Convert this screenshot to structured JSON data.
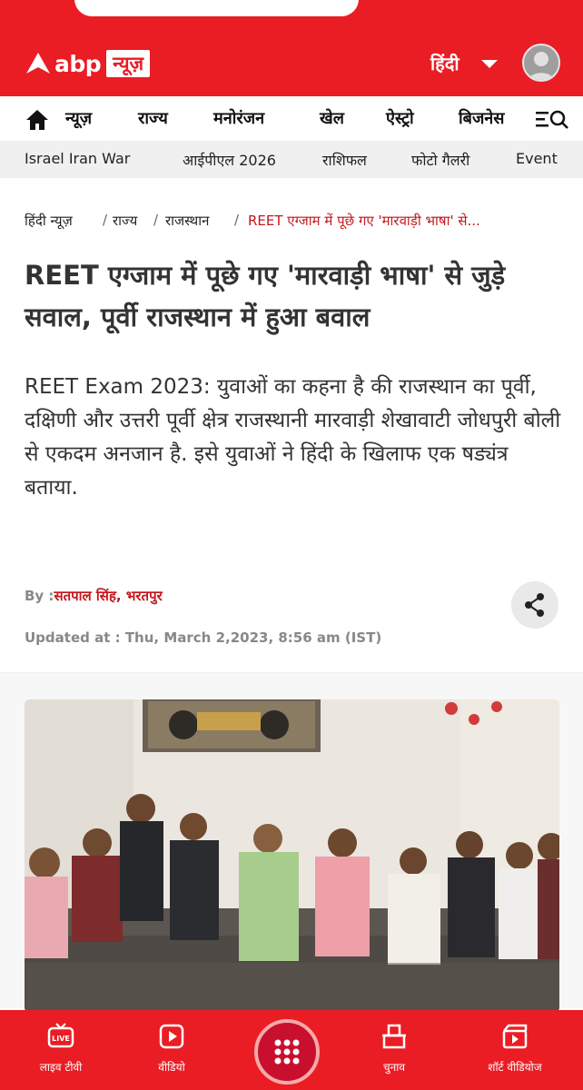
{
  "header": {
    "logo_abp": "abp",
    "logo_news": "न्यूज़",
    "language": "हिंदी",
    "brand_color": "#ea1c24"
  },
  "nav": {
    "items": [
      "न्यूज़",
      "राज्य",
      "मनोरंजन",
      "खेल",
      "ऐस्ट्रो",
      "बिजनेस"
    ]
  },
  "topics": [
    "Israel Iran War",
    "आईपीएल 2026",
    "राशिफल",
    "फोटो गैलरी",
    "Event"
  ],
  "breadcrumb": {
    "items": [
      "हिंदी न्यूज़",
      "राज्य",
      "राजस्थान"
    ],
    "current": "REET एग्जाम में पूछे गए 'मारवाड़ी भाषा' से...",
    "separator": "/"
  },
  "article": {
    "headline": "REET एग्जाम में पूछे गए 'मारवाड़ी भाषा' से जुड़े सवाल, पूर्वी राजस्थान में हुआ बवाल",
    "summary": "REET Exam 2023: युवाओं का कहना है की राजस्थान का पूर्वी, दक्षिणी और उत्तरी पूर्वी क्षेत्र राजस्थानी मारवाड़ी शेखावाटी जोधपुरी बोली से एकदम अनजान है. इसे युवाओं ने हिंदी के खिलाफ एक षड्यंत्र बताया.",
    "by_label": "By :",
    "author": "सतपाल सिंह, भरतपुर",
    "updated": "Updated at : Thu, March 2,2023, 8:56 am (IST)"
  },
  "bottom_nav": {
    "live_badge": "LIVE",
    "items": [
      {
        "label": "लाइव टीवी",
        "icon": "live-tv-icon"
      },
      {
        "label": "वीडियो",
        "icon": "video-play-icon"
      },
      {
        "label": "चुनाव",
        "icon": "ballot-box-icon"
      },
      {
        "label": "शॉर्ट वीडियोज",
        "icon": "short-video-icon"
      }
    ]
  }
}
